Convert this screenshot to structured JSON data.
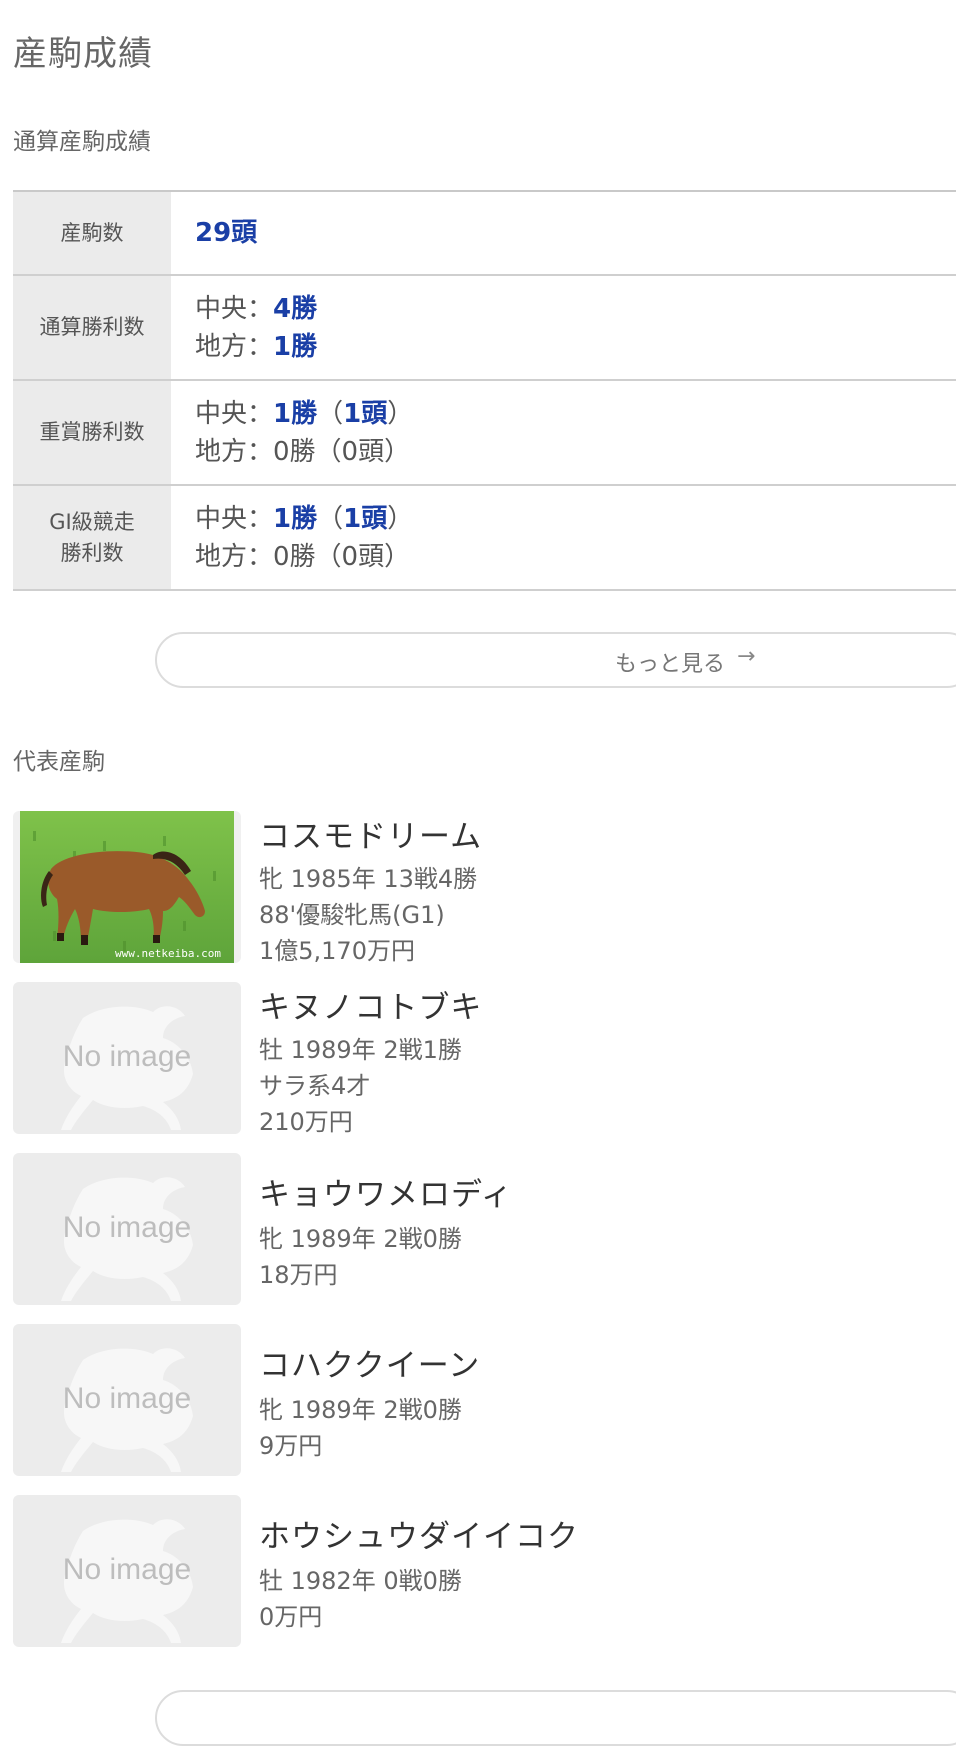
{
  "page": {
    "title": "産駒成績"
  },
  "sections": {
    "career_stats": "通算産駒成績",
    "representative": "代表産駒"
  },
  "stats": {
    "offspring_count": {
      "label": "産駒数",
      "value": "29頭"
    },
    "career_wins": {
      "label": "通算勝利数",
      "central_prefix": "中央：",
      "central": "4勝",
      "local_prefix": "地方：",
      "local": "1勝"
    },
    "graded_wins": {
      "label": "重賞勝利数",
      "central_prefix": "中央：",
      "central_wins": "1勝",
      "central_paren_open": "（",
      "central_horses": "1頭",
      "central_paren_close": "）",
      "local_prefix": "地方：",
      "local_text": "0勝（0頭）"
    },
    "g1_wins": {
      "label_line1": "GI級競走",
      "label_line2": "勝利数",
      "central_prefix": "中央：",
      "central_wins": "1勝",
      "central_paren_open": "（",
      "central_horses": "1頭",
      "central_paren_close": "）",
      "local_prefix": "地方：",
      "local_text": "0勝（0頭）"
    }
  },
  "more_button": {
    "label": "もっと見る",
    "arrow": "→"
  },
  "no_image_text": "No image",
  "photo_watermark": "www.netkeiba.com",
  "horses": [
    {
      "name": "コスモドリーム",
      "lines": [
        "牝 1985年 13戦4勝",
        "88'優駿牝馬(G1)",
        "1億5,170万円"
      ],
      "has_photo": true
    },
    {
      "name": "キヌノコトブキ",
      "lines": [
        "牡 1989年 2戦1勝",
        "サラ系4才",
        "210万円"
      ],
      "has_photo": false
    },
    {
      "name": "キョウワメロディ",
      "lines": [
        "牝 1989年 2戦0勝",
        "18万円"
      ],
      "has_photo": false
    },
    {
      "name": "コハククイーン",
      "lines": [
        "牝 1989年 2戦0勝",
        "9万円"
      ],
      "has_photo": false
    },
    {
      "name": "ホウシュウダイイコク",
      "lines": [
        "牡 1982年 0戦0勝",
        "0万円"
      ],
      "has_photo": false
    }
  ]
}
